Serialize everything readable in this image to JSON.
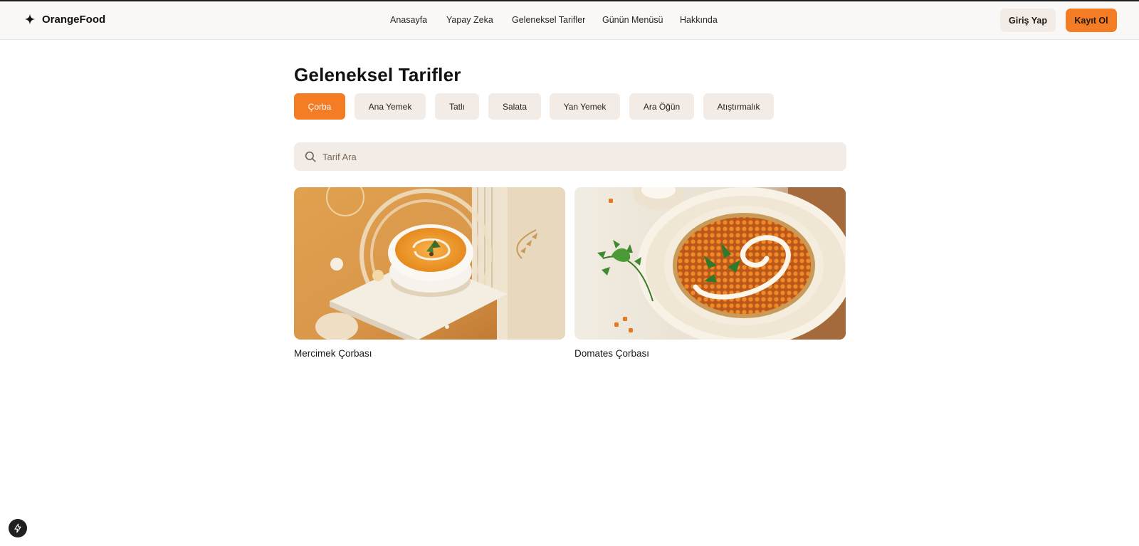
{
  "brand": {
    "name": "OrangeFood",
    "icon": "sparkle-icon"
  },
  "nav": {
    "items": [
      {
        "label": "Anasayfa"
      },
      {
        "label": "Yapay Zeka"
      },
      {
        "label": "Geleneksel Tarifler"
      },
      {
        "label": "Günün Menüsü"
      },
      {
        "label": "Hakkında"
      }
    ]
  },
  "auth": {
    "login_label": "Giriş Yap",
    "register_label": "Kayıt Ol"
  },
  "page": {
    "title": "Geleneksel Tarifler"
  },
  "categories": {
    "active": "Çorba",
    "items": [
      {
        "label": "Çorba"
      },
      {
        "label": "Ana Yemek"
      },
      {
        "label": "Tatlı"
      },
      {
        "label": "Salata"
      },
      {
        "label": "Yan Yemek"
      },
      {
        "label": "Ara Öğün"
      },
      {
        "label": "Atıştırmalık"
      }
    ]
  },
  "search": {
    "placeholder": "Tarif Ara",
    "value": "",
    "icon": "search-icon"
  },
  "recipes": [
    {
      "title": "Mercimek Çorbası",
      "image": "soup-bowl-image"
    },
    {
      "title": "Domates Çorbası",
      "image": "soup-bowl-image"
    }
  ],
  "colors": {
    "accent": "#f47c24",
    "chip": "#f3ece6",
    "header": "#faf8f6"
  }
}
